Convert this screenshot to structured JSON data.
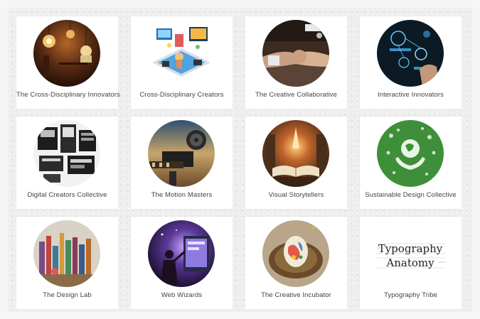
{
  "cards": [
    {
      "label": "The Cross-Disciplinary Innovators",
      "icon": "lightbulbs-image"
    },
    {
      "label": "Cross-Disciplinary Creators",
      "icon": "isometric-devices-image"
    },
    {
      "label": "The Creative Collaborative",
      "icon": "handshake-image"
    },
    {
      "label": "Interactive Innovators",
      "icon": "digital-interface-image"
    },
    {
      "label": "Digital Creators Collective",
      "icon": "ui-screens-image"
    },
    {
      "label": "The Motion Masters",
      "icon": "film-camera-image"
    },
    {
      "label": "Visual Storytellers",
      "icon": "open-book-image"
    },
    {
      "label": "Sustainable Design Collective",
      "icon": "green-globe-hands-image"
    },
    {
      "label": "The Design Lab",
      "icon": "bottles-image"
    },
    {
      "label": "Web Wizards",
      "icon": "wizard-screen-image"
    },
    {
      "label": "The Creative Incubator",
      "icon": "egg-nest-image"
    },
    {
      "label": "Typography Tribe",
      "icon": "typography-anatomy-image"
    }
  ],
  "typography_art": {
    "line1": "Typography",
    "line2": "Anatomy"
  }
}
